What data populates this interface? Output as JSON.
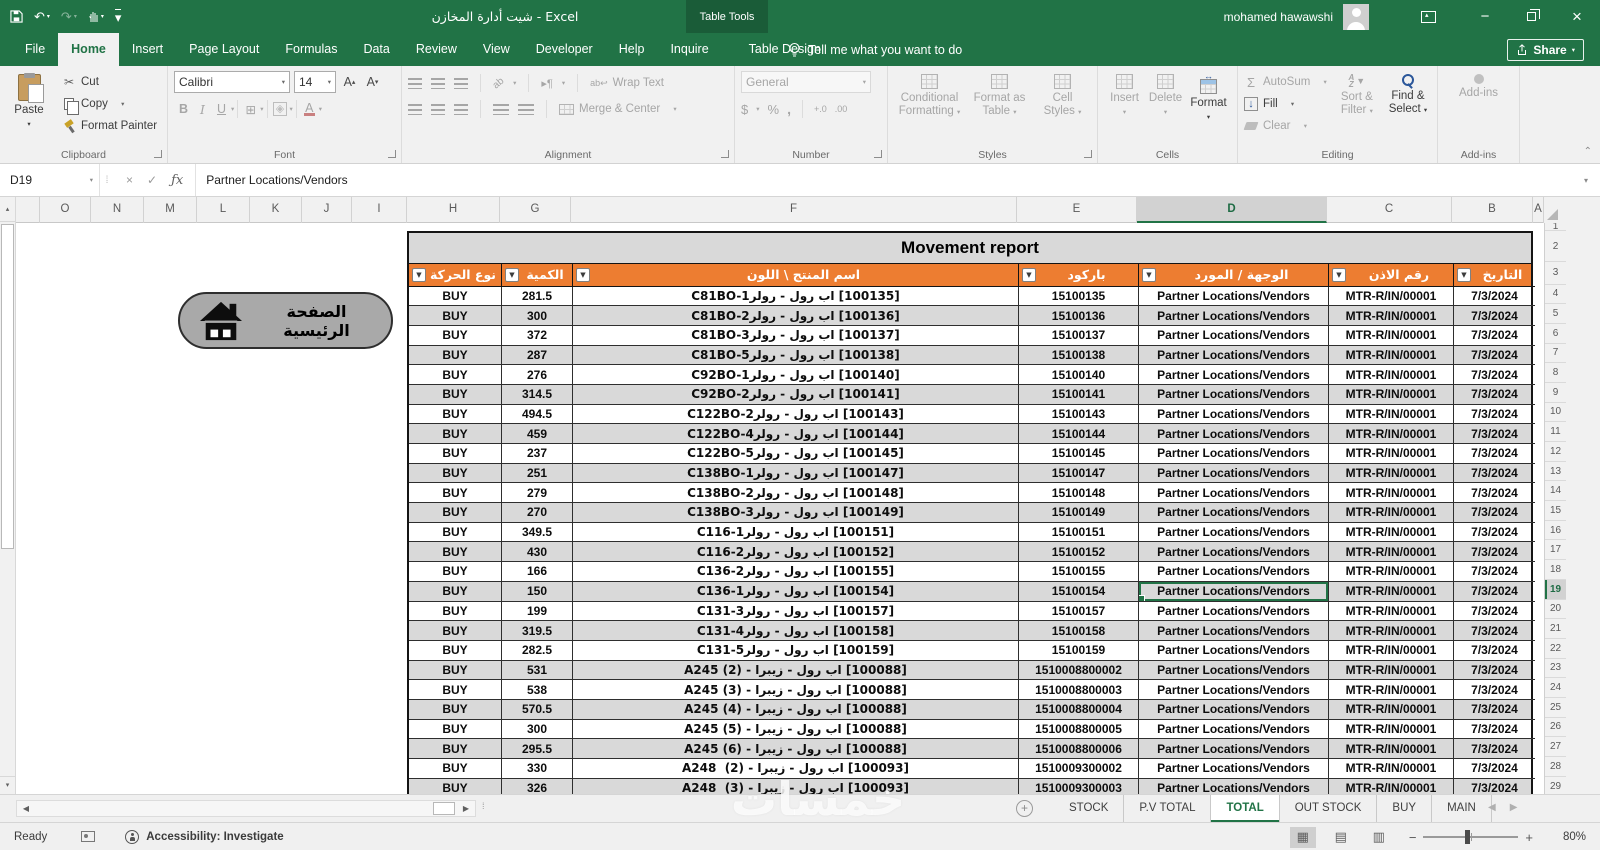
{
  "titlebar": {
    "title": "شيت أدارة المخازن - Excel",
    "context_tab_group": "Table Tools",
    "user": "mohamed hawawshi",
    "share": "Share"
  },
  "ribbon_tabs": {
    "items": [
      "File",
      "Home",
      "Insert",
      "Page Layout",
      "Formulas",
      "Data",
      "Review",
      "View",
      "Developer",
      "Help",
      "Inquire",
      "Table Design"
    ],
    "active": "Home",
    "tell_me": "Tell me what you want to do"
  },
  "ribbon": {
    "clipboard": {
      "label": "Clipboard",
      "paste": "Paste",
      "cut": "Cut",
      "copy": "Copy",
      "format_painter": "Format Painter"
    },
    "font": {
      "label": "Font",
      "font_name": "Calibri",
      "font_size": "14",
      "bold": "B",
      "italic": "I",
      "underline": "U"
    },
    "alignment": {
      "label": "Alignment",
      "wrap_text": "Wrap Text",
      "merge_center": "Merge & Center",
      "orientation": "ab",
      "text_dir": "¶"
    },
    "number": {
      "label": "Number",
      "format": "General",
      "currency": "$",
      "percent": "%",
      "comma": ",",
      "inc_dec": "+.0",
      "dec_dec": ".00"
    },
    "styles": {
      "label": "Styles",
      "conditional_1": "Conditional",
      "conditional_2": "Formatting",
      "format_table_1": "Format as",
      "format_table_2": "Table",
      "cell_styles_1": "Cell",
      "cell_styles_2": "Styles"
    },
    "cells": {
      "label": "Cells",
      "insert": "Insert",
      "delete": "Delete",
      "format": "Format"
    },
    "editing": {
      "label": "Editing",
      "autosum": "AutoSum",
      "fill": "Fill",
      "clear": "Clear",
      "sort_1": "Sort &",
      "sort_2": "Filter",
      "find_1": "Find &",
      "find_2": "Select"
    },
    "addins": {
      "label": "Add-ins",
      "button": "Add-ins"
    }
  },
  "formula_bar": {
    "name_box": "D19",
    "fx": "ƒx",
    "content": "Partner Locations/Vendors"
  },
  "sheet": {
    "columns": [
      "",
      "O",
      "N",
      "M",
      "L",
      "K",
      "J",
      "I",
      "H",
      "G",
      "F",
      "E",
      "D",
      "C",
      "B",
      "A"
    ],
    "selected_column": "D",
    "selected_row": "19",
    "row_numbers": [
      "1",
      "2",
      "3",
      "4",
      "5",
      "6",
      "7",
      "8",
      "9",
      "10",
      "11",
      "12",
      "13",
      "14",
      "15",
      "16",
      "17",
      "18",
      "19",
      "20",
      "21",
      "22",
      "23",
      "24",
      "25",
      "26",
      "27",
      "28",
      "29"
    ],
    "title": "Movement report",
    "home_button": "الصفحة الرئيسية",
    "headers": [
      "نوع الحركة",
      "الكمية",
      "اسم المنتج \\ اللون",
      "باركود",
      "الوجهة / المورد",
      "رقم الاذن",
      "التاريخ"
    ],
    "row_const": {
      "type": "BUY",
      "vendor": "Partner Locations/Vendors",
      "permit": "MTR-R/IN/00001",
      "date": "7/3/2024"
    },
    "rows": [
      {
        "type": "BUY",
        "qty": "281.5",
        "product": "⁦C81BO-1⁩⁧رولر⁩ - ⁧رول⁩ ⁧اب⁩ ⁦[100135]⁩",
        "barcode": "15100135",
        "vendor": "Partner Locations/Vendors",
        "permit": "MTR-R/IN/00001",
        "date": "7/3/2024"
      },
      {
        "type": "BUY",
        "qty": "300",
        "product": "⁦C81BO-2⁩⁧رولر⁩ - ⁧رول⁩ ⁧اب⁩ ⁦[100136]⁩",
        "barcode": "15100136",
        "vendor": "Partner Locations/Vendors",
        "permit": "MTR-R/IN/00001",
        "date": "7/3/2024"
      },
      {
        "type": "BUY",
        "qty": "372",
        "product": "⁦C81BO-3⁩⁧رولر⁩ - ⁧رول⁩ ⁧اب⁩ ⁦[100137]⁩",
        "barcode": "15100137",
        "vendor": "Partner Locations/Vendors",
        "permit": "MTR-R/IN/00001",
        "date": "7/3/2024"
      },
      {
        "type": "BUY",
        "qty": "287",
        "product": "⁦C81BO-5⁩⁧رولر⁩ - ⁧رول⁩ ⁧اب⁩ ⁦[100138]⁩",
        "barcode": "15100138",
        "vendor": "Partner Locations/Vendors",
        "permit": "MTR-R/IN/00001",
        "date": "7/3/2024"
      },
      {
        "type": "BUY",
        "qty": "276",
        "product": "⁦C92BO-1⁩⁧رولر⁩ - ⁧رول⁩ ⁧اب⁩ ⁦[100140]⁩",
        "barcode": "15100140",
        "vendor": "Partner Locations/Vendors",
        "permit": "MTR-R/IN/00001",
        "date": "7/3/2024"
      },
      {
        "type": "BUY",
        "qty": "314.5",
        "product": "⁦C92BO-2⁩⁧رولر⁩ - ⁧رول⁩ ⁧اب⁩ ⁦[100141]⁩",
        "barcode": "15100141",
        "vendor": "Partner Locations/Vendors",
        "permit": "MTR-R/IN/00001",
        "date": "7/3/2024"
      },
      {
        "type": "BUY",
        "qty": "494.5",
        "product": "⁦C122BO-2⁩⁧رولر⁩ - ⁧رول⁩ ⁧اب⁩ ⁦[100143]⁩",
        "barcode": "15100143",
        "vendor": "Partner Locations/Vendors",
        "permit": "MTR-R/IN/00001",
        "date": "7/3/2024"
      },
      {
        "type": "BUY",
        "qty": "459",
        "product": "⁦C122BO-4⁩⁧رولر⁩ - ⁧رول⁩ ⁧اب⁩ ⁦[100144]⁩",
        "barcode": "15100144",
        "vendor": "Partner Locations/Vendors",
        "permit": "MTR-R/IN/00001",
        "date": "7/3/2024"
      },
      {
        "type": "BUY",
        "qty": "237",
        "product": "⁦C122BO-5⁩⁧رولر⁩ - ⁧رول⁩ ⁧اب⁩ ⁦[100145]⁩",
        "barcode": "15100145",
        "vendor": "Partner Locations/Vendors",
        "permit": "MTR-R/IN/00001",
        "date": "7/3/2024"
      },
      {
        "type": "BUY",
        "qty": "251",
        "product": "⁦C138BO-1⁩⁧رولر⁩ - ⁧رول⁩ ⁧اب⁩ ⁦[100147]⁩",
        "barcode": "15100147",
        "vendor": "Partner Locations/Vendors",
        "permit": "MTR-R/IN/00001",
        "date": "7/3/2024"
      },
      {
        "type": "BUY",
        "qty": "279",
        "product": "⁦C138BO-2⁩⁧رولر⁩ - ⁧رول⁩ ⁧اب⁩ ⁦[100148]⁩",
        "barcode": "15100148",
        "vendor": "Partner Locations/Vendors",
        "permit": "MTR-R/IN/00001",
        "date": "7/3/2024"
      },
      {
        "type": "BUY",
        "qty": "270",
        "product": "⁦C138BO-3⁩⁧رولر⁩ - ⁧رول⁩ ⁧اب⁩ ⁦[100149]⁩",
        "barcode": "15100149",
        "vendor": "Partner Locations/Vendors",
        "permit": "MTR-R/IN/00001",
        "date": "7/3/2024"
      },
      {
        "type": "BUY",
        "qty": "349.5",
        "product": "⁦C116-1⁩⁧رولر⁩ - ⁧رول⁩ ⁧اب⁩ ⁦[100151]⁩",
        "barcode": "15100151",
        "vendor": "Partner Locations/Vendors",
        "permit": "MTR-R/IN/00001",
        "date": "7/3/2024"
      },
      {
        "type": "BUY",
        "qty": "430",
        "product": "⁦C116-2⁩⁧رولر⁩ - ⁧رول⁩ ⁧اب⁩ ⁦[100152]⁩",
        "barcode": "15100152",
        "vendor": "Partner Locations/Vendors",
        "permit": "MTR-R/IN/00001",
        "date": "7/3/2024"
      },
      {
        "type": "BUY",
        "qty": "166",
        "product": "⁦C136-2⁩⁧رولر⁩ - ⁧رول⁩ ⁧اب⁩ ⁦[100155]⁩",
        "barcode": "15100155",
        "vendor": "Partner Locations/Vendors",
        "permit": "MTR-R/IN/00001",
        "date": "7/3/2024"
      },
      {
        "type": "BUY",
        "qty": "150",
        "product": "⁦C136-1⁩⁧رولر⁩ - ⁧رول⁩ ⁧اب⁩ ⁦[100154]⁩",
        "barcode": "15100154",
        "vendor": "Partner Locations/Vendors",
        "permit": "MTR-R/IN/00001",
        "date": "7/3/2024",
        "selected": true
      },
      {
        "type": "BUY",
        "qty": "199",
        "product": "⁦C131-3⁩⁧رولر⁩ - ⁧رول⁩ ⁧اب⁩ ⁦[100157]⁩",
        "barcode": "15100157",
        "vendor": "Partner Locations/Vendors",
        "permit": "MTR-R/IN/00001",
        "date": "7/3/2024"
      },
      {
        "type": "BUY",
        "qty": "319.5",
        "product": "⁦C131-4⁩⁧رولر⁩ - ⁧رول⁩ ⁧اب⁩ ⁦[100158]⁩",
        "barcode": "15100158",
        "vendor": "Partner Locations/Vendors",
        "permit": "MTR-R/IN/00001",
        "date": "7/3/2024"
      },
      {
        "type": "BUY",
        "qty": "282.5",
        "product": "⁦C131-5⁩⁧رولر⁩ - ⁧رول⁩ ⁧اب⁩ ⁦[100159]⁩",
        "barcode": "15100159",
        "vendor": "Partner Locations/Vendors",
        "permit": "MTR-R/IN/00001",
        "date": "7/3/2024"
      },
      {
        "type": "BUY",
        "qty": "531",
        "product": "⁦A245 (2)⁩ - ⁧زيبرا⁩ - ⁧رول⁩ ⁧اب⁩ ⁦[100088]⁩",
        "barcode": "1510008800002",
        "vendor": "Partner Locations/Vendors",
        "permit": "MTR-R/IN/00001",
        "date": "7/3/2024"
      },
      {
        "type": "BUY",
        "qty": "538",
        "product": "⁦A245 (3)⁩ - ⁧زيبرا⁩ - ⁧رول⁩ ⁧اب⁩ ⁦[100088]⁩",
        "barcode": "1510008800003",
        "vendor": "Partner Locations/Vendors",
        "permit": "MTR-R/IN/00001",
        "date": "7/3/2024"
      },
      {
        "type": "BUY",
        "qty": "570.5",
        "product": "⁦A245 (4)⁩ - ⁧زيبرا⁩ - ⁧رول⁩ ⁧اب⁩ ⁦[100088]⁩",
        "barcode": "1510008800004",
        "vendor": "Partner Locations/Vendors",
        "permit": "MTR-R/IN/00001",
        "date": "7/3/2024"
      },
      {
        "type": "BUY",
        "qty": "300",
        "product": "⁦A245 (5)⁩ - ⁧زيبرا⁩ - ⁧رول⁩ ⁧اب⁩ ⁦[100088]⁩",
        "barcode": "1510008800005",
        "vendor": "Partner Locations/Vendors",
        "permit": "MTR-R/IN/00001",
        "date": "7/3/2024"
      },
      {
        "type": "BUY",
        "qty": "295.5",
        "product": "⁦A245 (6)⁩ - ⁧زيبرا⁩ - ⁧رول⁩ ⁧اب⁩ ⁦[100088]⁩",
        "barcode": "1510008800006",
        "vendor": "Partner Locations/Vendors",
        "permit": "MTR-R/IN/00001",
        "date": "7/3/2024"
      },
      {
        "type": "BUY",
        "qty": "330",
        "product": "⁦A248  (2)⁩ - ⁧زيبرا⁩ - ⁧رول⁩ ⁧اب⁩ ⁦[100093]⁩",
        "barcode": "1510009300002",
        "vendor": "Partner Locations/Vendors",
        "permit": "MTR-R/IN/00001",
        "date": "7/3/2024"
      },
      {
        "type": "BUY",
        "qty": "326",
        "product": "⁦A248  (3)⁩ - ⁧زيبرا⁩ - ⁧رول⁩ ⁧اب⁩ ⁦[100093]⁩",
        "barcode": "1510009300003",
        "vendor": "Partner Locations/Vendors",
        "permit": "MTR-R/IN/00001",
        "date": "7/3/2024"
      }
    ]
  },
  "sheet_tabs": {
    "items": [
      "STOCK",
      "P.V TOTAL",
      "TOTAL",
      "OUT STOCK",
      "BUY",
      "MAIN"
    ],
    "active": "TOTAL"
  },
  "status_bar": {
    "ready": "Ready",
    "accessibility": "Accessibility: Investigate",
    "zoom": "80%"
  },
  "watermark": "خمسات"
}
